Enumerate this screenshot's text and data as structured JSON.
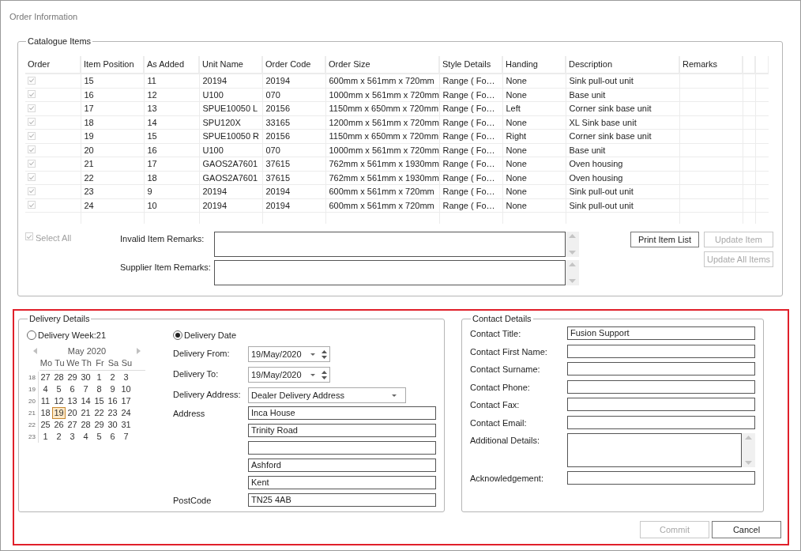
{
  "window": {
    "title": "Order Information"
  },
  "catalogue": {
    "title": "Catalogue Items",
    "order_column": "Order",
    "columns": [
      "Item Position",
      "As Added",
      "Unit Name",
      "Order Code",
      "Order Size",
      "Style Details",
      "Handing",
      "Description",
      "Remarks"
    ],
    "rows": [
      {
        "checked": true,
        "cells": [
          "15",
          "11",
          "20194",
          "20194",
          "600mm x 561mm x 720mm",
          "Range ( Fo…",
          "None",
          "Sink pull-out unit"
        ]
      },
      {
        "checked": true,
        "cells": [
          "16",
          "12",
          "U100",
          "070",
          "1000mm x 561mm x 720mm",
          "Range ( Fo…",
          "None",
          "Base unit"
        ]
      },
      {
        "checked": true,
        "cells": [
          "17",
          "13",
          "SPUE10050 L",
          "20156",
          "1150mm x 650mm x 720mm",
          "Range ( Fo…",
          "Left",
          "Corner sink base unit"
        ]
      },
      {
        "checked": true,
        "cells": [
          "18",
          "14",
          "SPU120X",
          "33165",
          "1200mm x 561mm x 720mm",
          "Range ( Fo…",
          "None",
          "XL Sink base unit"
        ]
      },
      {
        "checked": true,
        "cells": [
          "19",
          "15",
          "SPUE10050 R",
          "20156",
          "1150mm x 650mm x 720mm",
          "Range ( Fo…",
          "Right",
          "Corner sink base unit"
        ]
      },
      {
        "checked": true,
        "cells": [
          "20",
          "16",
          "U100",
          "070",
          "1000mm x 561mm x 720mm",
          "Range ( Fo…",
          "None",
          "Base unit"
        ]
      },
      {
        "checked": true,
        "cells": [
          "21",
          "17",
          "GAOS2A7601",
          "37615",
          "762mm x 561mm x 1930mm",
          "Range ( Fo…",
          "None",
          "Oven housing"
        ]
      },
      {
        "checked": true,
        "cells": [
          "22",
          "18",
          "GAOS2A7601",
          "37615",
          "762mm x 561mm x 1930mm",
          "Range ( Fo…",
          "None",
          "Oven housing"
        ]
      },
      {
        "checked": true,
        "cells": [
          "23",
          "9",
          "20194",
          "20194",
          "600mm x 561mm x 720mm",
          "Range ( Fo…",
          "None",
          "Sink pull-out unit"
        ]
      },
      {
        "checked": true,
        "cells": [
          "24",
          "10",
          "20194",
          "20194",
          "600mm x 561mm x 720mm",
          "Range ( Fo…",
          "None",
          "Sink pull-out unit"
        ]
      }
    ],
    "select_all": {
      "label": "Select All",
      "checked": true,
      "disabled": true
    },
    "remarks": [
      {
        "label": "Invalid Item Remarks:"
      },
      {
        "label": "Supplier Item Remarks:"
      }
    ],
    "buttons": [
      {
        "label": "Print Item List",
        "disabled": false
      },
      {
        "label": "Update Item",
        "disabled": true
      },
      {
        "label": "Update All Items",
        "disabled": true
      }
    ]
  },
  "delivery": {
    "title": "Delivery Details",
    "week_option": {
      "label": "Delivery Week:21",
      "selected": false
    },
    "date_option": {
      "label": "Delivery Date",
      "selected": true
    },
    "calendar": {
      "month": "May 2020",
      "weekdays": [
        "Mo",
        "Tu",
        "We",
        "Th",
        "Fr",
        "Sa",
        "Su"
      ],
      "weeks": [
        {
          "number": "18",
          "days": [
            {
              "day": "27",
              "selected": false
            },
            {
              "day": "28",
              "selected": false
            },
            {
              "day": "29",
              "selected": false
            },
            {
              "day": "30",
              "selected": false
            },
            {
              "day": "1",
              "selected": false
            },
            {
              "day": "2",
              "selected": false
            },
            {
              "day": "3",
              "selected": false
            }
          ]
        },
        {
          "number": "19",
          "days": [
            {
              "day": "4",
              "selected": false
            },
            {
              "day": "5",
              "selected": false
            },
            {
              "day": "6",
              "selected": false
            },
            {
              "day": "7",
              "selected": false
            },
            {
              "day": "8",
              "selected": false
            },
            {
              "day": "9",
              "selected": false
            },
            {
              "day": "10",
              "selected": false
            }
          ]
        },
        {
          "number": "20",
          "days": [
            {
              "day": "11",
              "selected": false
            },
            {
              "day": "12",
              "selected": false
            },
            {
              "day": "13",
              "selected": false
            },
            {
              "day": "14",
              "selected": false
            },
            {
              "day": "15",
              "selected": false
            },
            {
              "day": "16",
              "selected": false
            },
            {
              "day": "17",
              "selected": false
            }
          ]
        },
        {
          "number": "21",
          "days": [
            {
              "day": "18",
              "selected": false
            },
            {
              "day": "19",
              "selected": true
            },
            {
              "day": "20",
              "selected": false
            },
            {
              "day": "21",
              "selected": false
            },
            {
              "day": "22",
              "selected": false
            },
            {
              "day": "23",
              "selected": false
            },
            {
              "day": "24",
              "selected": false
            }
          ]
        },
        {
          "number": "22",
          "days": [
            {
              "day": "25",
              "selected": false
            },
            {
              "day": "26",
              "selected": false
            },
            {
              "day": "27",
              "selected": false
            },
            {
              "day": "28",
              "selected": false
            },
            {
              "day": "29",
              "selected": false
            },
            {
              "day": "30",
              "selected": false
            },
            {
              "day": "31",
              "selected": false
            }
          ]
        },
        {
          "number": "23",
          "days": [
            {
              "day": "1",
              "selected": false
            },
            {
              "day": "2",
              "selected": false
            },
            {
              "day": "3",
              "selected": false
            },
            {
              "day": "4",
              "selected": false
            },
            {
              "day": "5",
              "selected": false
            },
            {
              "day": "6",
              "selected": false
            },
            {
              "day": "7",
              "selected": false
            }
          ]
        }
      ]
    },
    "delivery_from": {
      "label": "Delivery From:",
      "value": "19/May/2020"
    },
    "delivery_to": {
      "label": "Delivery To:",
      "value": "19/May/2020"
    },
    "delivery_address": {
      "label": "Delivery Address:",
      "value": "Dealer Delivery Address"
    },
    "address": {
      "label": "Address",
      "lines": [
        {
          "kind": "filled",
          "value": "Inca House"
        },
        {
          "kind": "filled",
          "value": "Trinity Road"
        },
        {
          "kind": "empty"
        },
        {
          "kind": "filled",
          "value": "Ashford"
        },
        {
          "kind": "filled",
          "value": "Kent"
        }
      ]
    },
    "postcode": {
      "label": "PostCode",
      "value": "TN25 4AB"
    }
  },
  "contact": {
    "title": "Contact Details",
    "fields": [
      {
        "kind": "text",
        "label": "Contact Title:",
        "value": "Fusion Support"
      },
      {
        "kind": "text",
        "label": "Contact First Name:"
      },
      {
        "kind": "text",
        "label": "Contact Surname:"
      },
      {
        "kind": "text",
        "label": "Contact Phone:"
      },
      {
        "kind": "text",
        "label": "Contact Fax:"
      },
      {
        "kind": "text",
        "label": "Contact Email:"
      },
      {
        "kind": "textarea",
        "label": "Additional Details:"
      },
      {
        "kind": "text",
        "label": "Acknowledgement:"
      }
    ]
  },
  "footer_buttons": [
    {
      "label": "Commit",
      "disabled": true
    },
    {
      "label": "Cancel",
      "disabled": false
    }
  ]
}
